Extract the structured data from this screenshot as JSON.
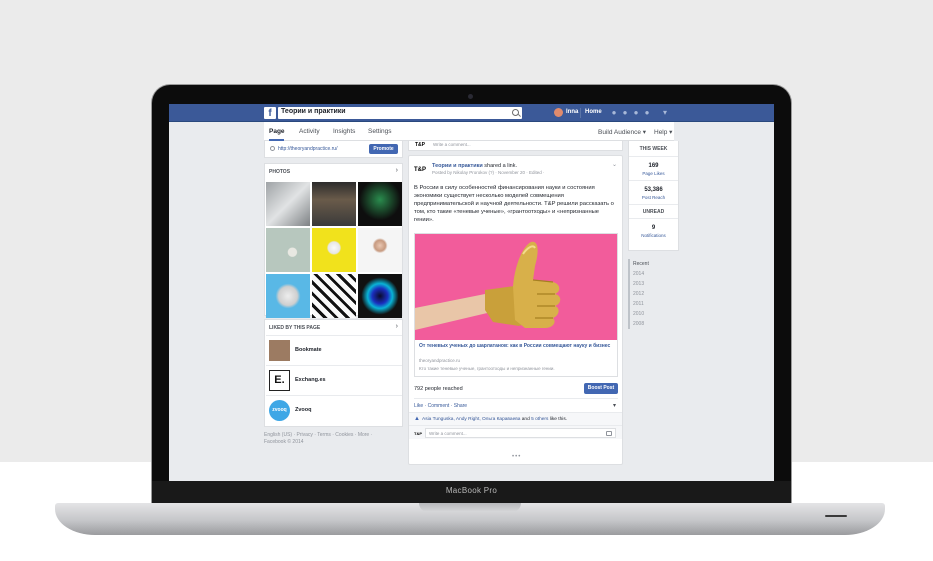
{
  "device": {
    "label": "MacBook Pro"
  },
  "topbar": {
    "page_name": "Теории и практики",
    "user": "Inna",
    "home": "Home"
  },
  "nav": {
    "tabs": [
      "Page",
      "Activity",
      "Insights",
      "Settings"
    ],
    "build_audience": "Build Audience ▾",
    "help": "Help ▾"
  },
  "left": {
    "url": "http://theoryandpractice.ru/",
    "promote": "Promote",
    "photos_title": "PHOTOS",
    "liked_title": "LIKED BY THIS PAGE",
    "liked": [
      "Bookmate",
      "Exchang.es",
      "Zvooq"
    ],
    "logo_texts": [
      "E.",
      "zvooq"
    ],
    "footer": "English (US) · Privacy · Terms · Cookies · More ·\nFacebook © 2014"
  },
  "post": {
    "composer_placeholder": "Write a comment...",
    "avatar": "T&P",
    "author": "Теории и практики",
    "action": " shared a link.",
    "meta": "Posted by Nikolay Prorokov (?) · November 20 · Edited ·",
    "text": "В России в силу особенностей финансирования науки и состояния экономики существует несколько моделей совмещения предпринимательской и научной деятельности. T&P решили рассказать о том, кто такие «теневые ученые», «грантоотходы» и «непризнанные гении».",
    "link_title": "От теневых ученых до шарлатанов: как в России совмещают науку и бизнес",
    "link_domain": "theoryandpractice.ru",
    "link_desc": "Кто такие теневые ученые, грантоотходы и непризнанные гении.",
    "reached": "792 people reached",
    "boost": "Boost Post",
    "actions": "Like · Comment · Share",
    "likes_names": "Asia Tunguska, Andy Right, Ольга Караваева",
    "likes_and": " and ",
    "likes_others": "5 others",
    "likes_suffix": " like this.",
    "comment_placeholder": "Write a comment..."
  },
  "right": {
    "this_week": "THIS WEEK",
    "likes_num": "169",
    "likes_lbl": "Page Likes",
    "reach_num": "53,386",
    "reach_lbl": "Post Reach",
    "unread": "UNREAD",
    "notif_num": "9",
    "notif_lbl": "Notifications",
    "years": [
      "Recent",
      "2014",
      "2013",
      "2012",
      "2011",
      "2010",
      "2008"
    ]
  },
  "colors": {
    "facebook_blue": "#3b5998",
    "button_blue": "#4267b2",
    "link_image_pink": "#f25c9b",
    "gold_hand": "#c9a03a"
  }
}
